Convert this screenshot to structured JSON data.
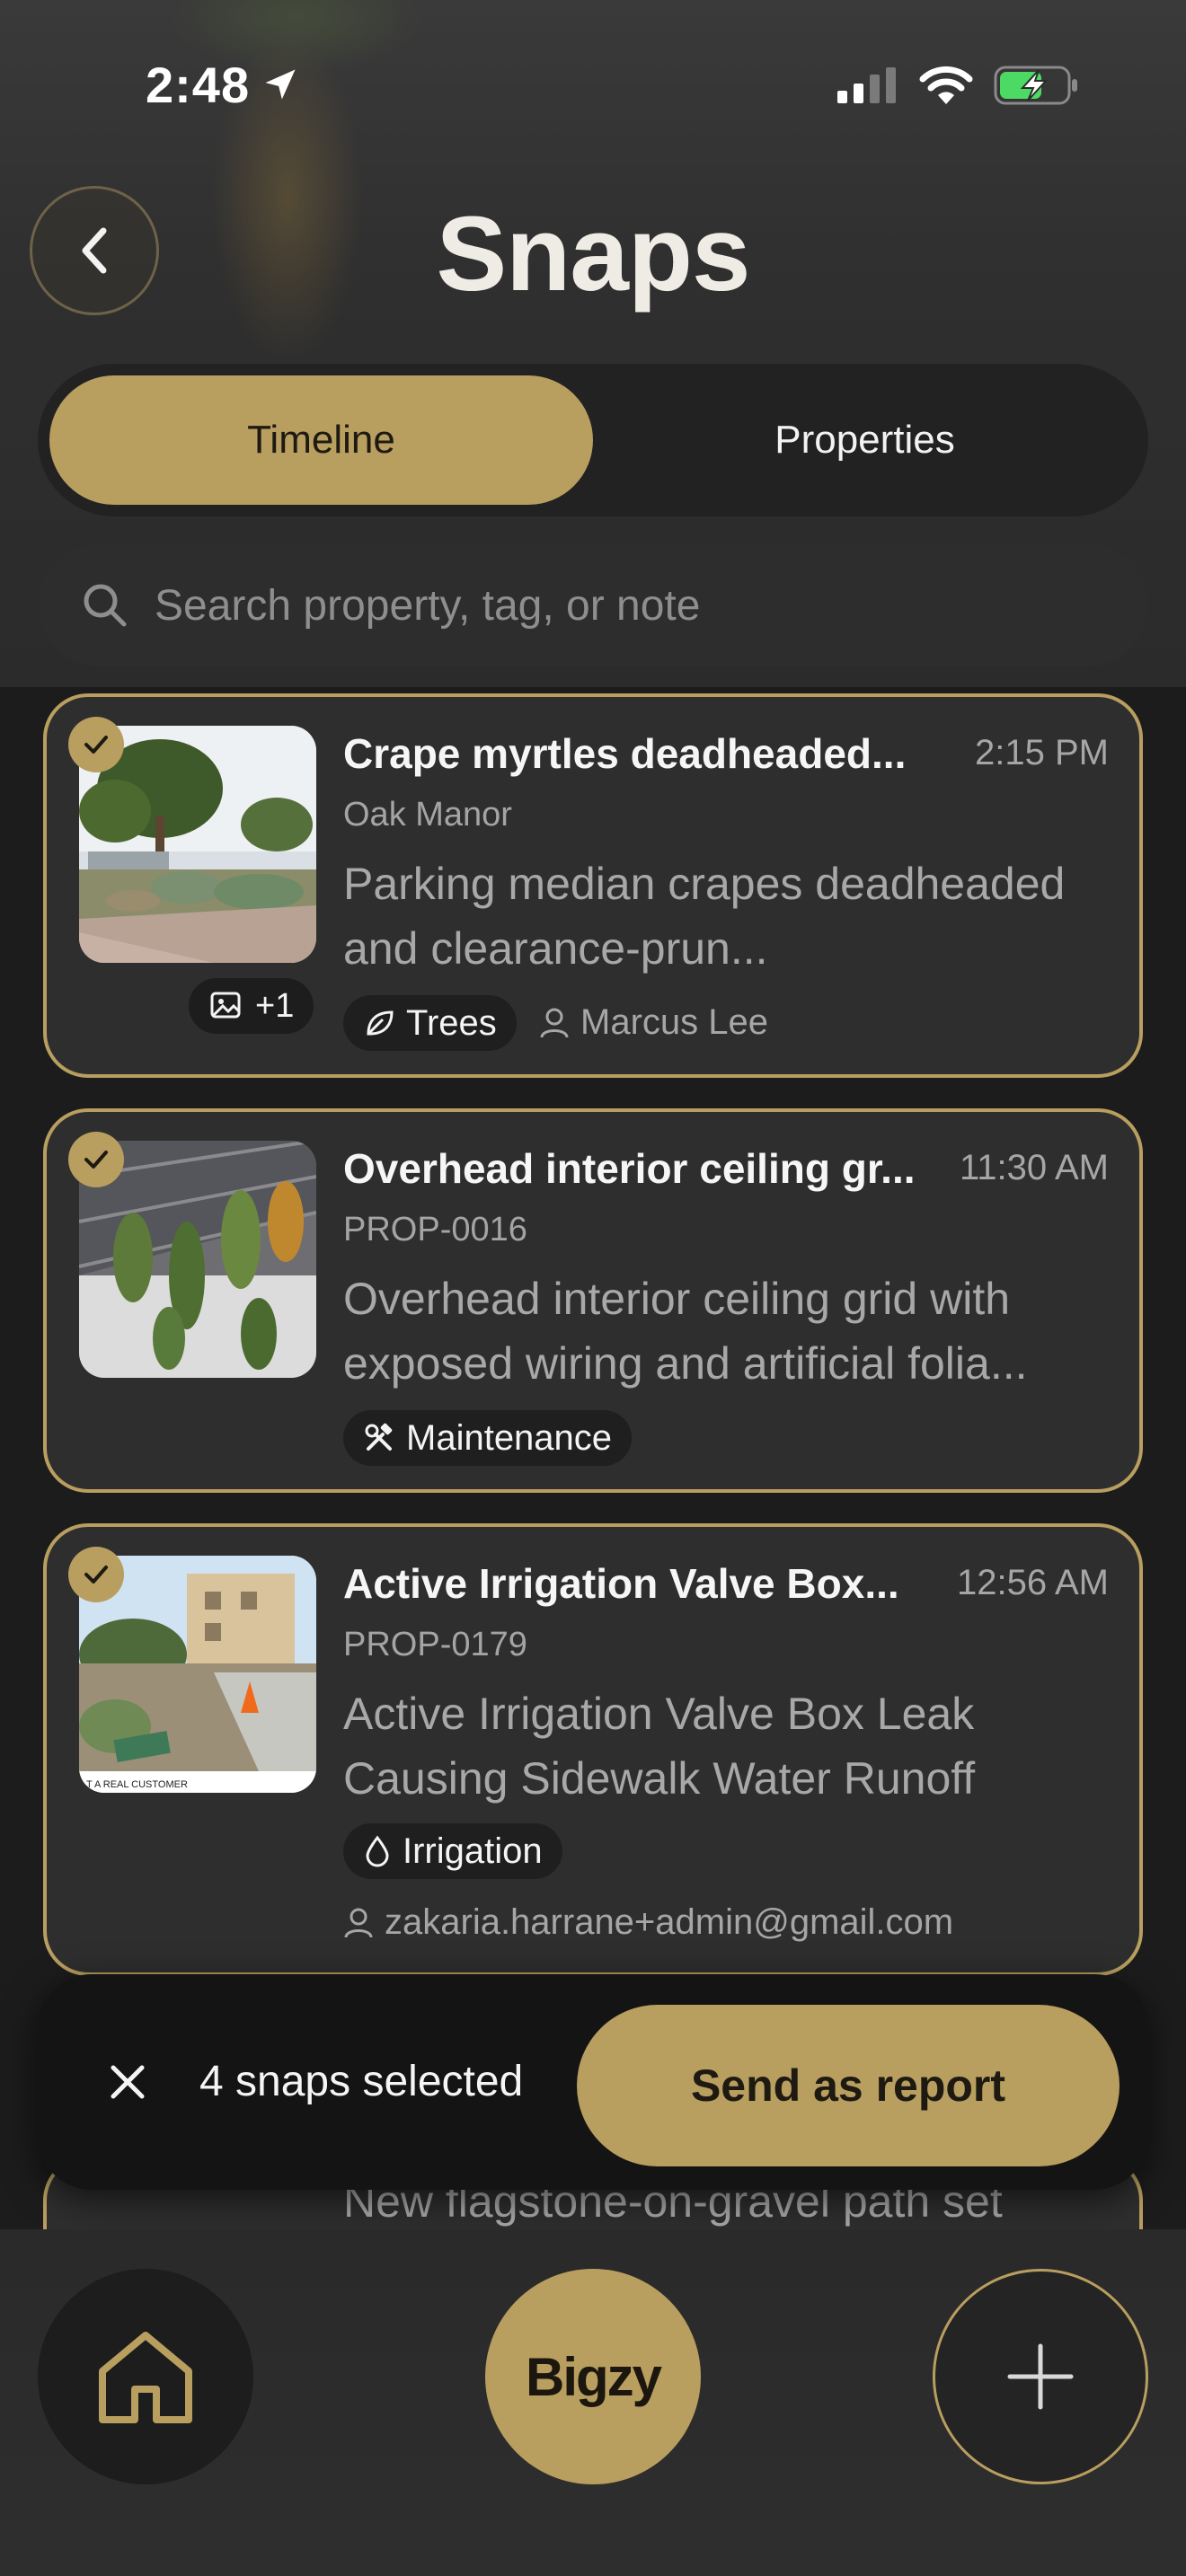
{
  "status_bar": {
    "time": "2:48"
  },
  "header": {
    "title": "Snaps",
    "back_icon": "chevron-left-icon"
  },
  "tabs": [
    {
      "label": "Timeline",
      "active": true
    },
    {
      "label": "Properties",
      "active": false
    }
  ],
  "search": {
    "placeholder": "Search property, tag, or note",
    "value": ""
  },
  "snaps": [
    {
      "selected": true,
      "title": "Crape myrtles deadheaded...",
      "time": "2:15 PM",
      "property": "Oak Manor",
      "note": "Parking median crapes deadheaded and clearance-prun...",
      "photo_count": "+1",
      "tag": {
        "icon": "leaf-icon",
        "label": "Trees"
      },
      "assignee": "Marcus Lee"
    },
    {
      "selected": true,
      "title": "Overhead interior ceiling gr...",
      "time": "11:30 AM",
      "property": "PROP-0016",
      "note": "Overhead interior ceiling grid with exposed wiring and artificial folia...",
      "tag": {
        "icon": "tools-icon",
        "label": "Maintenance"
      }
    },
    {
      "selected": true,
      "title": "Active Irrigation Valve Box...",
      "time": "12:56 AM",
      "property": "PROP-0179",
      "note": "Active Irrigation Valve Box Leak Causing Sidewalk Water Runoff",
      "thumb_caption": "T A REAL CUSTOMER",
      "tag": {
        "icon": "water-drop-icon",
        "label": "Irrigation"
      },
      "assignee": "zakaria.harrane+admin@gmail.com"
    },
    {
      "peek_note": "New flagstone-on-gravel path set"
    }
  ],
  "selection_bar": {
    "count_text": "4 snaps selected",
    "action_label": "Send as report"
  },
  "bottom_nav": {
    "center_label": "Bigzy"
  },
  "colors": {
    "accent": "#b89e5f",
    "background": "#1c1c1c",
    "card": "#2e2e2e"
  }
}
